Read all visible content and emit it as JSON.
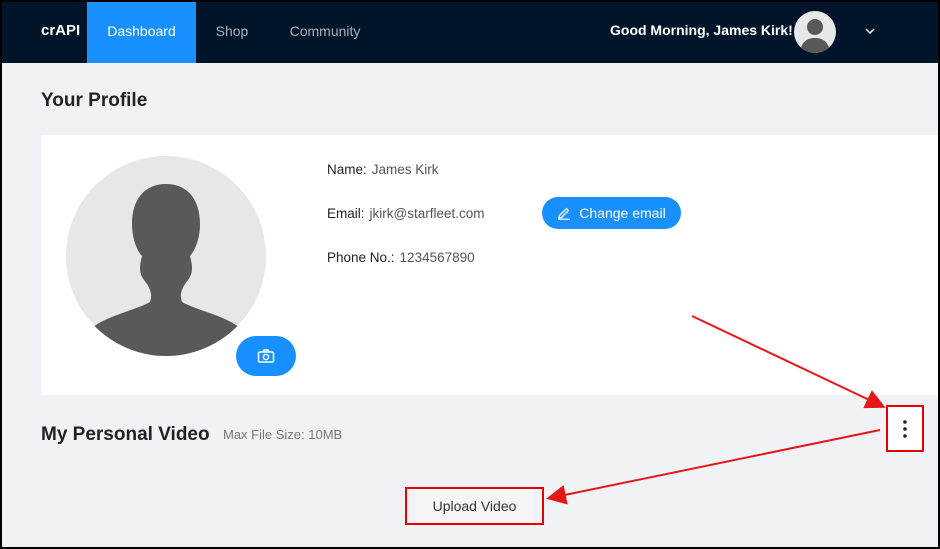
{
  "header": {
    "logo": "crAPI",
    "tabs": [
      {
        "label": "Dashboard",
        "active": true
      },
      {
        "label": "Shop",
        "active": false
      },
      {
        "label": "Community",
        "active": false
      }
    ],
    "greeting": "Good Morning, James Kirk!",
    "avatar_icon": "user-avatar-icon",
    "dropdown_icon": "chevron-down-icon"
  },
  "profile": {
    "title": "Your Profile",
    "name_label": "Name:",
    "name_value": "James Kirk",
    "email_label": "Email:",
    "email_value": "jkirk@starfleet.com",
    "phone_label": "Phone No.:",
    "phone_value": "1234567890",
    "change_email_label": "Change email",
    "camera_icon": "camera-icon"
  },
  "video": {
    "title": "My Personal Video",
    "max_size": "Max File Size: 10MB",
    "upload_label": "Upload Video",
    "more_icon": "more-vertical-icon"
  },
  "colors": {
    "header_bg": "#001529",
    "accent": "#1890ff",
    "annotation_red": "#e60000"
  }
}
